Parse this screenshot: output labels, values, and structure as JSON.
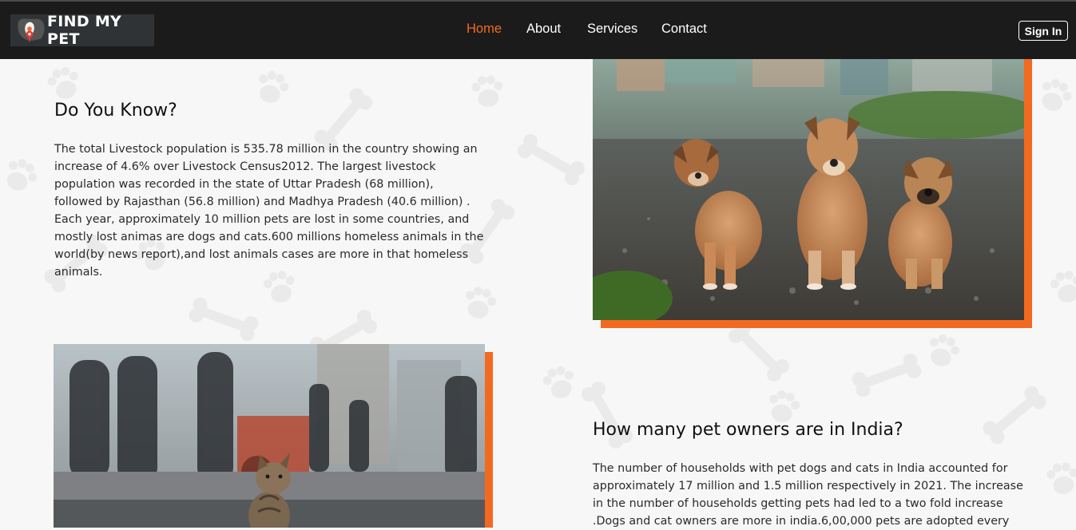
{
  "brand": {
    "name": "FIND MY PET",
    "logo_icon": "pet-location-pin-icon"
  },
  "nav": {
    "items": [
      {
        "label": "Home",
        "active": true
      },
      {
        "label": "About",
        "active": false
      },
      {
        "label": "Services",
        "active": false
      },
      {
        "label": "Contact",
        "active": false
      }
    ],
    "signin_label": "Sign In"
  },
  "colors": {
    "accent": "#f26a21",
    "navbar_bg": "#1b1b1b",
    "page_bg": "#f7f7f7"
  },
  "section1": {
    "title": "Do You Know?",
    "lines": [
      "The total Livestock population is 535.78 million in the country showing an",
      "increase of 4.6% over Livestock Census2012. The largest livestock",
      "population was recorded in the state of Uttar Pradesh (68 million),",
      "followed by Rajasthan (56.8 million) and Madhya Pradesh (40.6 million) .",
      "Each year, approximately 10 million pets are lost in some countries, and",
      "mostly lost animas are dogs and cats.600 millions homeless animals in the",
      "world(by news report),and lost animals cases are more in that homeless",
      "animals."
    ],
    "image": "three-puppies-photo"
  },
  "section2": {
    "title": "How many pet owners are in India?",
    "lines": [
      "The number of households with pet dogs and cats in India accounted for",
      "approximately 17 million and 1.5 million respectively in 2021. The increase",
      "in the number of households getting pets had led to a two fold increase",
      ".Dogs and cat owners are more in india.6,00,000 pets are adopted every"
    ],
    "image": "street-cat-photo"
  }
}
